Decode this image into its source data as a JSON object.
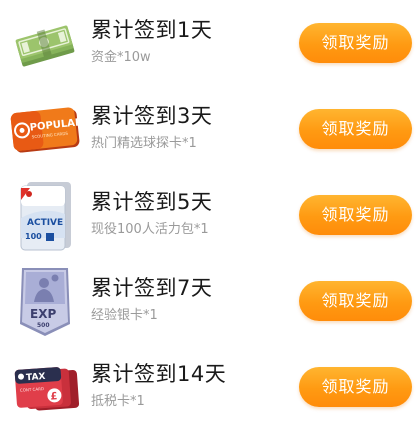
{
  "rewards": [
    {
      "title": "累计签到1天",
      "reward": "资金*10w",
      "button_label": "领取奖励",
      "icon": "cash-bundle-icon"
    },
    {
      "title": "累计签到3天",
      "reward": "热门精选球探卡*1",
      "button_label": "领取奖励",
      "icon": "popular-scouting-card-icon",
      "icon_text": "POPULAR",
      "icon_subtext": "SCOUTING CARDS"
    },
    {
      "title": "累计签到5天",
      "reward": "现役100人活力包*1",
      "button_label": "领取奖励",
      "icon": "active-player-pack-icon",
      "icon_text": "ACTIVE",
      "icon_subtext": "100"
    },
    {
      "title": "累计签到7天",
      "reward": "经验银卡*1",
      "button_label": "领取奖励",
      "icon": "exp-silver-card-icon",
      "icon_text": "EXP",
      "icon_subtext": "500"
    },
    {
      "title": "累计签到14天",
      "reward": "抵税卡*1",
      "button_label": "领取奖励",
      "icon": "tax-deduction-card-icon",
      "icon_text": "TAX",
      "icon_subtext": "CONT CARD"
    }
  ],
  "colors": {
    "button": "#ff9a12",
    "title": "#1a1a1a",
    "subtitle": "#9a9a9a"
  }
}
